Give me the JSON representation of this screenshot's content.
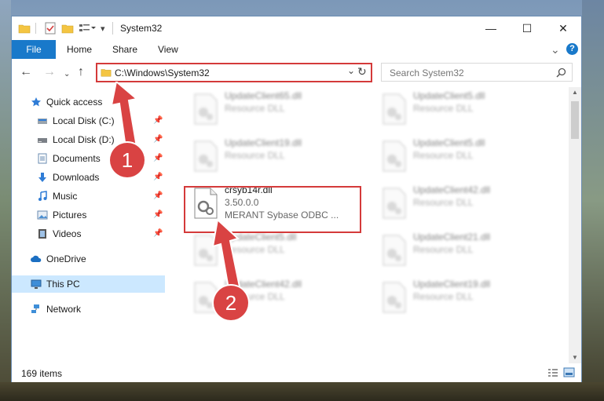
{
  "window": {
    "title": "System32",
    "minimize": "—",
    "maximize": "☐",
    "close": "✕"
  },
  "ribbon": {
    "tabs": [
      "File",
      "Home",
      "Share",
      "View"
    ],
    "expand": "⌄",
    "help": "?"
  },
  "navbar": {
    "address": "C:\\Windows\\System32",
    "search_placeholder": "Search System32"
  },
  "sidebar": {
    "items": [
      {
        "label": "Quick access",
        "icon": "star-icon"
      },
      {
        "label": "Local Disk (C:)",
        "icon": "drive-icon"
      },
      {
        "label": "Local Disk (D:)",
        "icon": "drive-icon"
      },
      {
        "label": "Documents",
        "icon": "documents-icon"
      },
      {
        "label": "Downloads",
        "icon": "downloads-icon"
      },
      {
        "label": "Music",
        "icon": "music-icon"
      },
      {
        "label": "Pictures",
        "icon": "pictures-icon"
      },
      {
        "label": "Videos",
        "icon": "videos-icon"
      },
      {
        "label": "OneDrive",
        "icon": "cloud-icon"
      },
      {
        "label": "This PC",
        "icon": "computer-icon"
      },
      {
        "label": "Network",
        "icon": "network-icon"
      }
    ]
  },
  "files": [
    {
      "name": "UpdateClient65.dll",
      "desc": "Resource DLL"
    },
    {
      "name": "UpdateClient5.dll",
      "desc": "Resource DLL"
    },
    {
      "name": "UpdateClient19.dll",
      "desc": "Resource DLL"
    },
    {
      "name": "UpdateClient5.dll",
      "desc": "Resource DLL"
    },
    {
      "name": "crsyb14r.dll",
      "desc": "3.50.0.0",
      "desc2": "MERANT Sybase ODBC ..."
    },
    {
      "name": "UpdateClient42.dll",
      "desc": "Resource DLL"
    },
    {
      "name": "UpdateClient5.dll",
      "desc": "Resource DLL"
    },
    {
      "name": "UpdateClient21.dll",
      "desc": "Resource DLL"
    },
    {
      "name": "UpdateClient42.dll",
      "desc": "Resource DLL"
    },
    {
      "name": "UpdateClient19.dll",
      "desc": "Resource DLL"
    }
  ],
  "status": {
    "count": "169 items"
  },
  "annotations": {
    "step1": "1",
    "step2": "2"
  },
  "colors": {
    "accent": "#1979ca",
    "highlight": "#d43a3a",
    "selected": "#cce8ff"
  }
}
